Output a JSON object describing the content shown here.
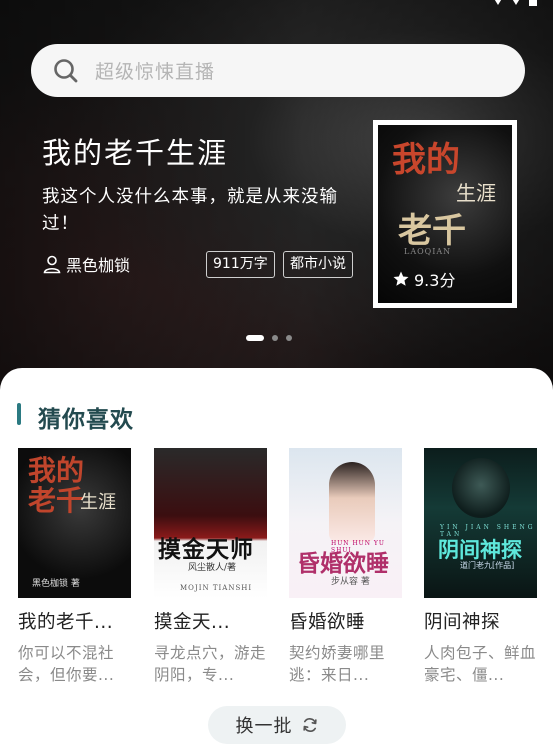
{
  "status_bar": {
    "time": ""
  },
  "search": {
    "placeholder": "超级惊悚直播"
  },
  "featured": {
    "title": "我的老千生涯",
    "description": "我这个人没什么本事，就是从来没输过！",
    "author": "黑色枷锁",
    "word_count": "911万字",
    "genre": "都市小说",
    "rating": "9.3分",
    "cover_text": {
      "line1": "我的",
      "line2": "老千",
      "line3": "生涯",
      "sub": "LAOQIAN"
    }
  },
  "carousel": {
    "count": 3,
    "active_index": 0
  },
  "section": {
    "title": "猜你喜欢"
  },
  "books": [
    {
      "title": "我的老千...",
      "description": "你可以不混社会，但你要...",
      "cover": {
        "big": "我的老千",
        "side": "生涯",
        "author": "黑色枷锁 著"
      }
    },
    {
      "title": "摸金天...",
      "description": "寻龙点穴，游走阴阳，专...",
      "cover": {
        "big": "摸金天师",
        "author": "风尘散人/著",
        "sub": "MOJIN TIANSHI"
      }
    },
    {
      "title": "昏婚欲睡",
      "description": "契约娇妻哪里逃：来日...",
      "cover": {
        "big": "昏婚欲睡",
        "author": "步从容 著",
        "sub": "HUN HUN YU SHUI"
      }
    },
    {
      "title": "阴间神探",
      "description": "人肉包子、鲜血豪宅、僵...",
      "cover": {
        "big": "阴间神探",
        "author": "道门老九[作品]",
        "sub": "YIN JIAN SHENG TAN"
      }
    }
  ],
  "refresh_button": {
    "label": "换一批"
  },
  "colors": {
    "accent": "#2b7a82",
    "section_title": "#234a4f",
    "muted": "#8a8a8a"
  },
  "icons": {
    "search": "search-icon",
    "author": "person-icon",
    "rating": "star-icon",
    "refresh": "refresh-icon"
  }
}
